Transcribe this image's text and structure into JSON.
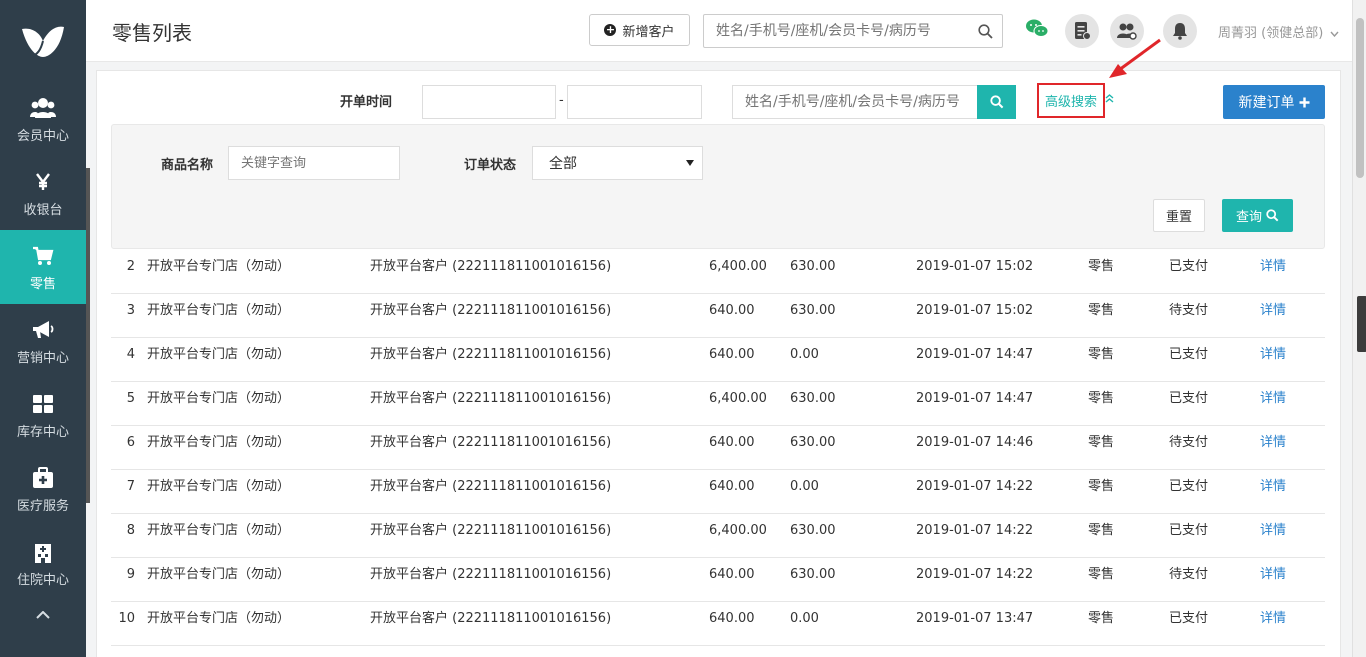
{
  "sidebar": {
    "items": [
      {
        "label": "会员中心",
        "icon": "members-icon",
        "active": false
      },
      {
        "label": "收银台",
        "icon": "yen-icon",
        "active": false
      },
      {
        "label": "零售",
        "icon": "cart-icon",
        "active": true
      },
      {
        "label": "营销中心",
        "icon": "megaphone-icon",
        "active": false
      },
      {
        "label": "库存中心",
        "icon": "grid-icon",
        "active": false
      },
      {
        "label": "医疗服务",
        "icon": "medkit-icon",
        "active": false
      },
      {
        "label": "住院中心",
        "icon": "hospital-icon",
        "active": false
      }
    ],
    "more_icon": "chevron-up-icon",
    "accent": "#1fb5ad",
    "bg": "#2f3e4a"
  },
  "header": {
    "title": "零售列表",
    "new_customer_label": "新增客户",
    "search_placeholder": "姓名/手机号/座机/会员卡号/病历号",
    "user_name": "周菁羽 (领健总部)"
  },
  "filters": {
    "date_label": "开单时间",
    "date_separator": "-",
    "search_placeholder": "姓名/手机号/座机/会员卡号/病历号",
    "advanced_label": "高级搜索",
    "new_order_label": "新建订单",
    "product_label": "商品名称",
    "product_placeholder": "关键字查询",
    "status_label": "订单状态",
    "status_value": "全部",
    "reset_label": "重置",
    "query_label": "查询"
  },
  "orders": [
    {
      "no": "2",
      "store": "开放平台专门店（勿动）",
      "customer": "开放平台客户 (222111811001016156)",
      "amount": "6,400.00",
      "paid": "630.00",
      "time": "2019-01-07 15:02",
      "type": "零售",
      "status": "已支付",
      "action": "详情"
    },
    {
      "no": "3",
      "store": "开放平台专门店（勿动）",
      "customer": "开放平台客户 (222111811001016156)",
      "amount": "640.00",
      "paid": "630.00",
      "time": "2019-01-07 15:02",
      "type": "零售",
      "status": "待支付",
      "action": "详情"
    },
    {
      "no": "4",
      "store": "开放平台专门店（勿动）",
      "customer": "开放平台客户 (222111811001016156)",
      "amount": "640.00",
      "paid": "0.00",
      "time": "2019-01-07 14:47",
      "type": "零售",
      "status": "已支付",
      "action": "详情"
    },
    {
      "no": "5",
      "store": "开放平台专门店（勿动）",
      "customer": "开放平台客户 (222111811001016156)",
      "amount": "6,400.00",
      "paid": "630.00",
      "time": "2019-01-07 14:47",
      "type": "零售",
      "status": "已支付",
      "action": "详情"
    },
    {
      "no": "6",
      "store": "开放平台专门店（勿动）",
      "customer": "开放平台客户 (222111811001016156)",
      "amount": "640.00",
      "paid": "630.00",
      "time": "2019-01-07 14:46",
      "type": "零售",
      "status": "待支付",
      "action": "详情"
    },
    {
      "no": "7",
      "store": "开放平台专门店（勿动）",
      "customer": "开放平台客户 (222111811001016156)",
      "amount": "640.00",
      "paid": "0.00",
      "time": "2019-01-07 14:22",
      "type": "零售",
      "status": "已支付",
      "action": "详情"
    },
    {
      "no": "8",
      "store": "开放平台专门店（勿动）",
      "customer": "开放平台客户 (222111811001016156)",
      "amount": "6,400.00",
      "paid": "630.00",
      "time": "2019-01-07 14:22",
      "type": "零售",
      "status": "已支付",
      "action": "详情"
    },
    {
      "no": "9",
      "store": "开放平台专门店（勿动）",
      "customer": "开放平台客户 (222111811001016156)",
      "amount": "640.00",
      "paid": "630.00",
      "time": "2019-01-07 14:22",
      "type": "零售",
      "status": "待支付",
      "action": "详情"
    },
    {
      "no": "10",
      "store": "开放平台专门店（勿动）",
      "customer": "开放平台客户 (222111811001016156)",
      "amount": "640.00",
      "paid": "0.00",
      "time": "2019-01-07 13:47",
      "type": "零售",
      "status": "已支付",
      "action": "详情"
    }
  ],
  "colors": {
    "teal": "#1fb5ad",
    "blue": "#2b82cc",
    "highlight_red": "#e0262a"
  }
}
